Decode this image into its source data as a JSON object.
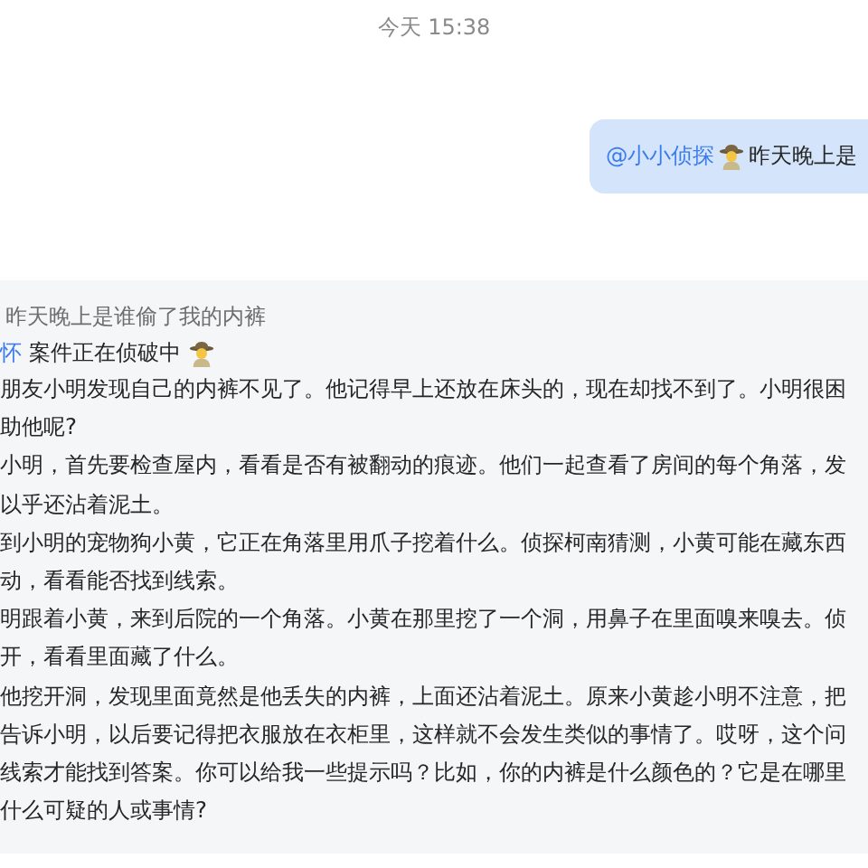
{
  "timestamp": "今天 15:38",
  "user_message": {
    "mention": "@小小侦探",
    "text": "昨天晚上是"
  },
  "reply": {
    "quote": "昨天晚上是谁偷了我的内裤",
    "mention": "怀",
    "status": "案件正在侦破中",
    "lines": [
      "朋友小明发现自己的内裤不见了。他记得早上还放在床头的，现在却找不到了。小明很困",
      "助他呢?",
      "小明，首先要检查屋内，看看是否有被翻动的痕迹。他们一起查看了房间的每个角落，发",
      "以乎还沾着泥土。",
      "到小明的宠物狗小黄，它正在角落里用爪子挖着什么。侦探柯南猜测，小黄可能在藏东西",
      "动，看看能否找到线索。",
      "明跟着小黄，来到后院的一个角落。小黄在那里挖了一个洞，用鼻子在里面嗅来嗅去。侦",
      "开，看看里面藏了什么。",
      "他挖开洞，发现里面竟然是他丢失的内裤，上面还沾着泥土。原来小黄趁小明不注意，把",
      "告诉小明，以后要记得把衣服放在衣柜里，这样就不会发生类似的事情了。哎呀，这个问",
      "线索才能找到答案。你可以给我一些提示吗？比如，你的内裤是什么颜色的？它是在哪里",
      "什么可疑的人或事情?"
    ]
  }
}
